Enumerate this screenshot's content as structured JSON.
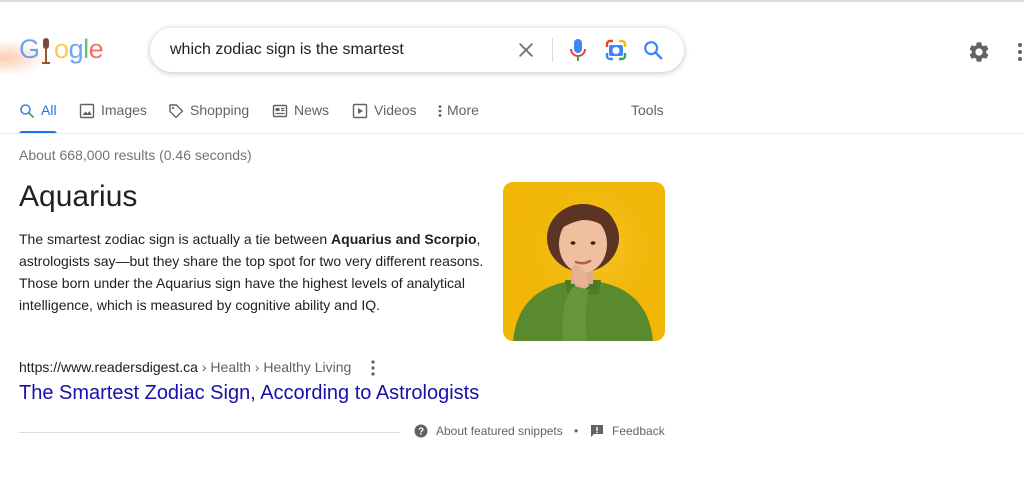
{
  "logo": {
    "text": "Google"
  },
  "search": {
    "query": "which zodiac sign is the smartest",
    "placeholder": ""
  },
  "icons": {
    "clear": "close-icon",
    "mic": "microphone-icon",
    "lens": "camera-lens-icon",
    "submit": "search-icon",
    "settings": "gear-icon",
    "apps": "apps-grid-icon"
  },
  "tabs": [
    {
      "label": "All",
      "icon": "search-icon",
      "active": true
    },
    {
      "label": "Images",
      "icon": "image-icon"
    },
    {
      "label": "Shopping",
      "icon": "tag-icon"
    },
    {
      "label": "News",
      "icon": "newspaper-icon"
    },
    {
      "label": "Videos",
      "icon": "play-icon"
    },
    {
      "label": "More",
      "icon": "dots-vertical-icon"
    }
  ],
  "tools_label": "Tools",
  "results": {
    "stats": "About 668,000 results (0.46 seconds)",
    "answer": "Aquarius",
    "snippet": {
      "part1": "The smartest zodiac sign is actually a tie between ",
      "bold": "Aquarius and Scorpio",
      "part2": ", astrologists say—but they share the top spot for two very different reasons. Those born under the Aquarius sign have the highest levels of analytical intelligence, which is measured by cognitive ability and IQ."
    },
    "source": {
      "domain": "https://www.readersdigest.ca",
      "crumbs": " › Health › Healthy Living",
      "title": "The Smartest Zodiac Sign, According to Astrologists"
    },
    "footer": {
      "about": "About featured snippets",
      "dot": "•",
      "feedback": "Feedback"
    }
  },
  "colors": {
    "accent": "#1a73e8",
    "link": "#1a0dab",
    "image_background": "#f2b705"
  }
}
